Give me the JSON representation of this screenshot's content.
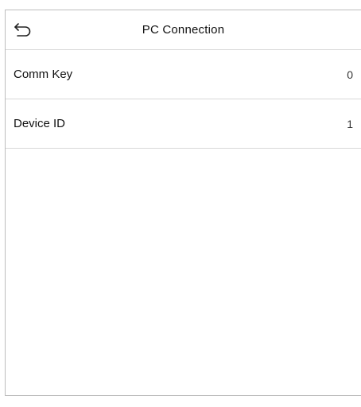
{
  "header": {
    "title": "PC Connection",
    "back_icon": "undo-arrow-icon"
  },
  "settings": [
    {
      "label": "Comm Key",
      "value": "0"
    },
    {
      "label": "Device ID",
      "value": "1"
    }
  ],
  "colors": {
    "background": "#ffffff",
    "divider": "#d8d8d8",
    "text": "#111111"
  }
}
